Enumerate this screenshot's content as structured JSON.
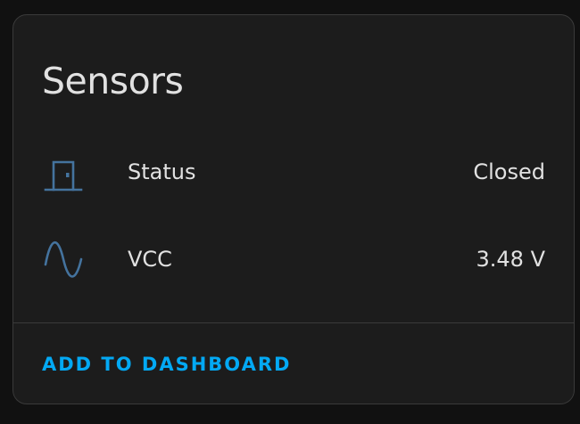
{
  "card": {
    "title": "Sensors",
    "entities": [
      {
        "icon": "door-closed-icon",
        "name": "Status",
        "value": "Closed"
      },
      {
        "icon": "sine-wave-icon",
        "name": "VCC",
        "value": "3.48 V"
      }
    ],
    "action_label": "ADD TO DASHBOARD"
  },
  "colors": {
    "icon": "#44739e",
    "accent": "#03a9f4",
    "card_background": "#1c1c1c",
    "text": "#e1e1e1"
  }
}
